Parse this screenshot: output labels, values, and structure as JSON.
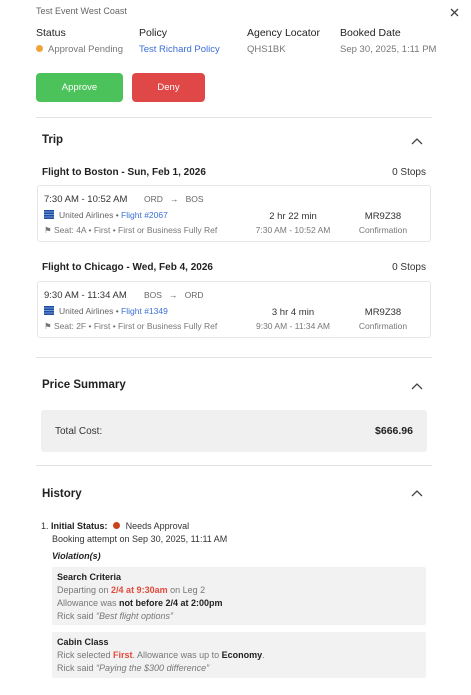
{
  "event_name": "Test Event West Coast",
  "header": {
    "status_label": "Status",
    "status_value": "Approval Pending",
    "policy_label": "Policy",
    "policy_value": "Test Richard Policy",
    "locator_label": "Agency Locator",
    "locator_value": "QHS1BK",
    "booked_label": "Booked Date",
    "booked_value": "Sep 30, 2025, 1:11 PM"
  },
  "actions": {
    "approve": "Approve",
    "deny": "Deny"
  },
  "trip": {
    "title": "Trip",
    "flights": [
      {
        "title": "Flight to Boston - Sun, Feb 1, 2026",
        "stops": "0 Stops",
        "times": "7:30 AM - 10:52 AM",
        "from": "ORD",
        "to": "BOS",
        "airline": "United Airlines",
        "flight": "Flight #2067",
        "seat": "Seat: 4A • First • First or Business Fully Ref",
        "duration": "2 hr 22 min",
        "span": "7:30 AM - 10:52 AM",
        "confirmation": "MR9Z38",
        "confirmation_label": "Confirmation"
      },
      {
        "title": "Flight to Chicago - Wed, Feb 4, 2026",
        "stops": "0 Stops",
        "times": "9:30 AM - 11:34 AM",
        "from": "BOS",
        "to": "ORD",
        "airline": "United Airlines",
        "flight": "Flight #1349",
        "seat": "Seat: 2F • First • First or Business Fully Ref",
        "duration": "3 hr 4 min",
        "span": "9:30 AM - 11:34 AM",
        "confirmation": "MR9Z38",
        "confirmation_label": "Confirmation"
      }
    ]
  },
  "price": {
    "title": "Price Summary",
    "total_label": "Total Cost:",
    "total_value": "$666.96"
  },
  "history": {
    "title": "History",
    "item_number": "1.",
    "initial_status_label": "Initial Status:",
    "initial_status_value": "Needs Approval",
    "booking_attempt": "Booking attempt on Sep 30, 2025, 11:11 AM",
    "violations_label": "Violation(s)",
    "violations": [
      {
        "title": "Search Criteria",
        "line1_pre": "Departing on ",
        "line1_hl": "2/4 at 9:30am",
        "line1_post": " on Leg 2",
        "line2_pre": "Allowance was ",
        "line2_hl": "not before 2/4 at 2:00pm",
        "line3_pre": "Rick said ",
        "line3_quote": "“Best flight options”"
      },
      {
        "title": "Cabin Class",
        "line1_pre": "Rick selected ",
        "line1_hl": "First",
        "line1_post": ". Allowance was up to ",
        "line1_hl2": "Economy",
        "line1_end": ".",
        "line3_pre": "Rick said ",
        "line3_quote": "“Paying the $300 difference”"
      }
    ]
  },
  "colors": {
    "approve": "#4cc35a",
    "deny": "#e04747",
    "pending_dot": "#f0a33a",
    "needs_approval_dot": "#c8431c",
    "link": "#3b6fd6",
    "violation_highlight": "#e24a3c"
  }
}
